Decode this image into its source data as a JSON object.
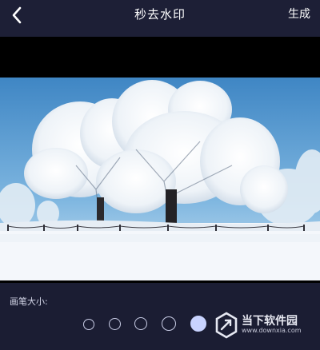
{
  "header": {
    "back_icon": "chevron-left-icon",
    "title": "秒去水印",
    "action_label": "生成"
  },
  "image": {
    "subject": "snow-covered frosted trees with blue sky"
  },
  "brush": {
    "label": "画笔大小:",
    "sizes": [
      "size-1",
      "size-2",
      "size-3",
      "size-4",
      "size-5"
    ],
    "selected_index": 4
  },
  "watermark": {
    "name": "当下软件园",
    "url": "www.downxia.com",
    "icon": "downxia-logo-icon"
  },
  "colors": {
    "background": "#1b1d33",
    "accent": "#c9d3ff"
  }
}
